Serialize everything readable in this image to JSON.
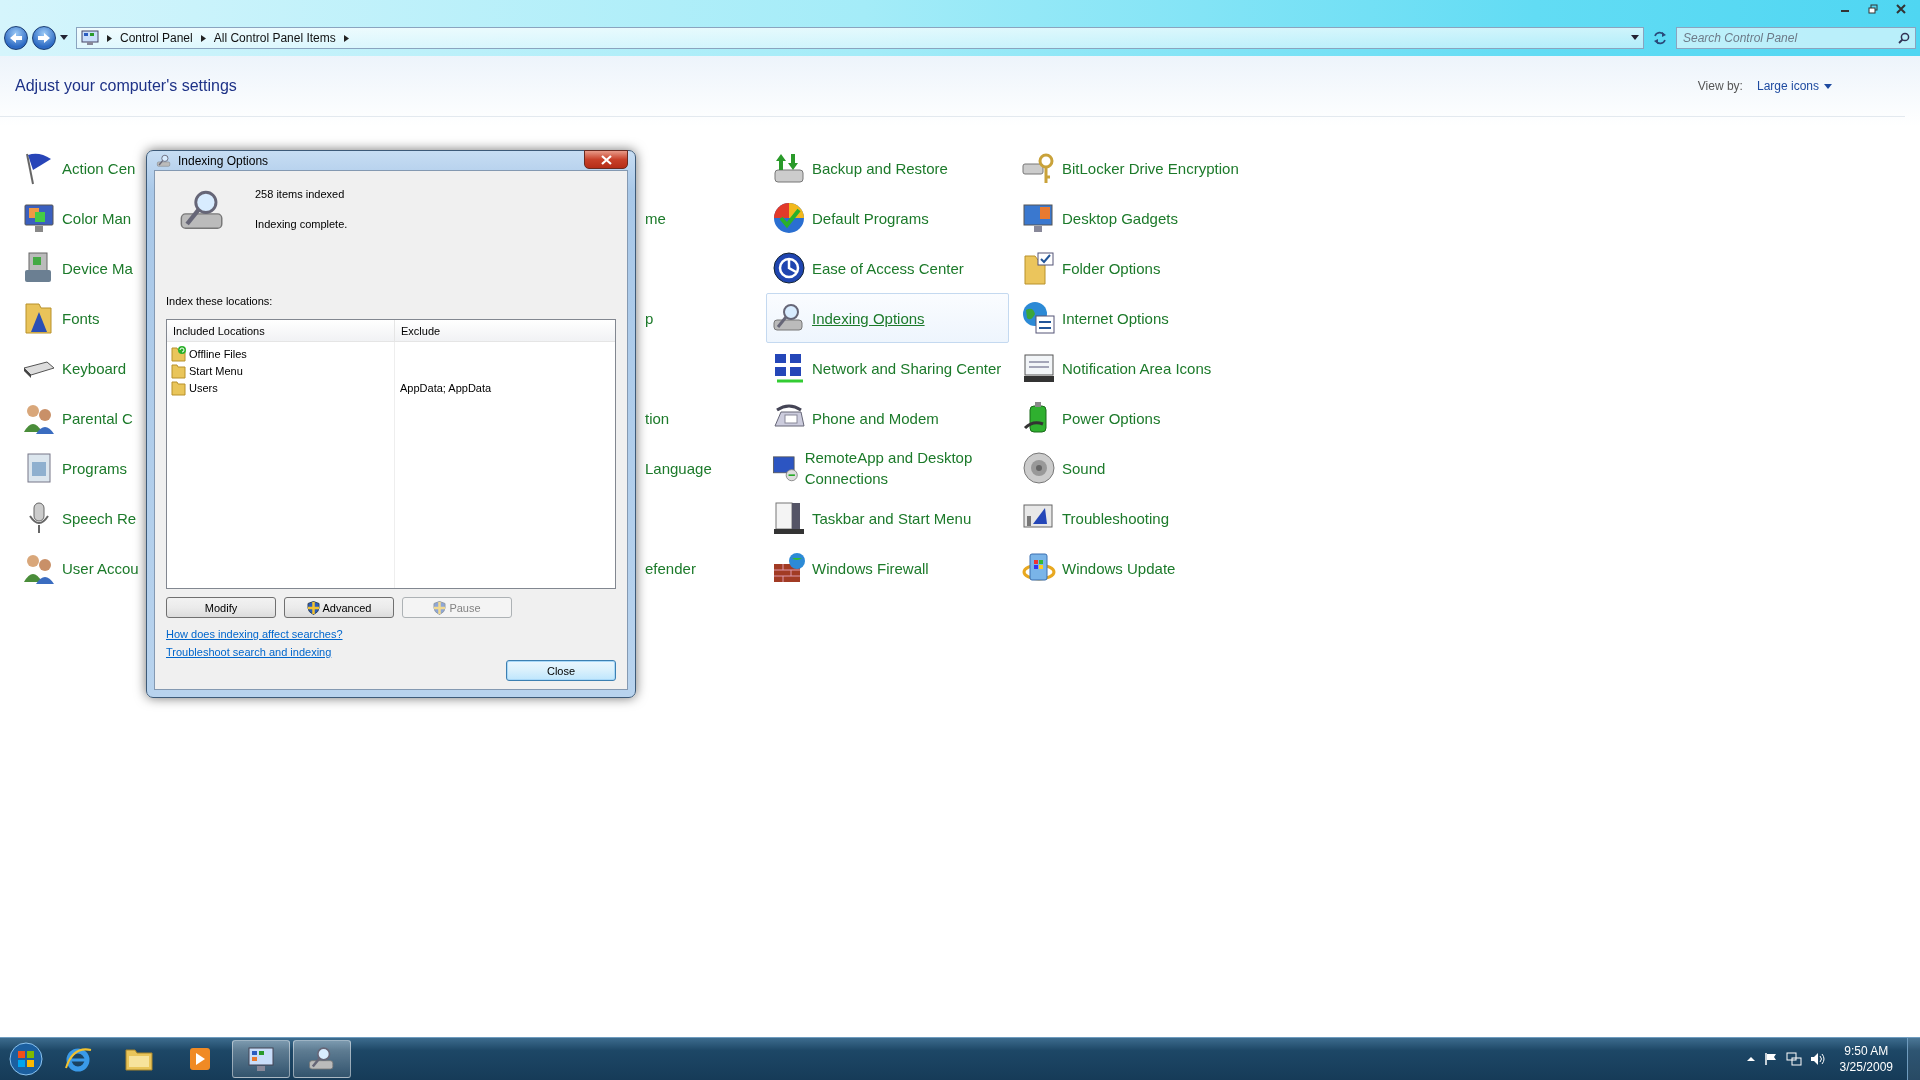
{
  "window": {
    "breadcrumbs": [
      "Control Panel",
      "All Control Panel Items"
    ],
    "search": {
      "placeholder": "Search Control Panel"
    },
    "heading": "Adjust your computer's settings",
    "view_by": {
      "label": "View by:",
      "value": "Large icons"
    }
  },
  "columns": [
    {
      "covered": false,
      "items": [
        {
          "kind": "item",
          "label": "Action Cen",
          "hovered": false
        },
        {
          "kind": "item",
          "label": "Color Man",
          "hovered": false
        },
        {
          "kind": "item",
          "label": "Device Ma",
          "hovered": false
        },
        {
          "kind": "item",
          "label": "Fonts",
          "hovered": false
        },
        {
          "kind": "item",
          "label": "Keyboard",
          "hovered": false
        },
        {
          "kind": "item",
          "label": "Parental C",
          "hovered": false
        },
        {
          "kind": "item",
          "label": "Programs",
          "hovered": false
        },
        {
          "kind": "item",
          "label": "Speech Re",
          "hovered": false
        },
        {
          "kind": "item",
          "label": "User Accou",
          "hovered": false
        }
      ]
    },
    {
      "covered": true
    },
    {
      "covered": false,
      "items": [
        {
          "kind": "covered"
        },
        {
          "kind": "tail",
          "label": "me"
        },
        {
          "kind": "covered"
        },
        {
          "kind": "tail",
          "label": "p"
        },
        {
          "kind": "covered"
        },
        {
          "kind": "tail",
          "label": "tion"
        },
        {
          "kind": "tail",
          "label": "Language"
        },
        {
          "kind": "covered"
        },
        {
          "kind": "tail",
          "label": "efender"
        }
      ]
    },
    {
      "covered": false,
      "items": [
        {
          "kind": "item",
          "label": "Backup and Restore",
          "hovered": false
        },
        {
          "kind": "item",
          "label": "Default Programs",
          "hovered": false
        },
        {
          "kind": "item",
          "label": "Ease of Access Center",
          "hovered": false
        },
        {
          "kind": "item",
          "label": "Indexing Options",
          "hovered": true
        },
        {
          "kind": "item",
          "label": "Network and Sharing Center",
          "hovered": false
        },
        {
          "kind": "item",
          "label": "Phone and Modem",
          "hovered": false
        },
        {
          "kind": "item",
          "label": "RemoteApp and Desktop Connections",
          "hovered": false
        },
        {
          "kind": "item",
          "label": "Taskbar and Start Menu",
          "hovered": false
        },
        {
          "kind": "item",
          "label": "Windows Firewall",
          "hovered": false
        }
      ]
    },
    {
      "covered": false,
      "items": [
        {
          "kind": "item",
          "label": "BitLocker Drive Encryption",
          "hovered": false
        },
        {
          "kind": "item",
          "label": "Desktop Gadgets",
          "hovered": false
        },
        {
          "kind": "item",
          "label": "Folder Options",
          "hovered": false
        },
        {
          "kind": "item",
          "label": "Internet Options",
          "hovered": false
        },
        {
          "kind": "item",
          "label": "Notification Area Icons",
          "hovered": false
        },
        {
          "kind": "item",
          "label": "Power Options",
          "hovered": false
        },
        {
          "kind": "item",
          "label": "Sound",
          "hovered": false
        },
        {
          "kind": "item",
          "label": "Troubleshooting",
          "hovered": false
        },
        {
          "kind": "item",
          "label": "Windows Update",
          "hovered": false
        }
      ]
    }
  ],
  "dialog": {
    "title": "Indexing Options",
    "items_indexed": "258 items indexed",
    "status": "Indexing complete.",
    "locations_label": "Index these locations:",
    "columns": [
      "Included Locations",
      "Exclude"
    ],
    "rows": [
      {
        "kind": "offline",
        "location": "Offline Files"
      },
      {
        "kind": "folder",
        "location": "Start Menu"
      },
      {
        "kind": "folder",
        "location": "Users",
        "exclude": "AppData; AppData"
      }
    ],
    "buttons": [
      {
        "label": "Modify",
        "shield": false,
        "disabled": false
      },
      {
        "label": "Advanced",
        "shield": true,
        "disabled": false
      },
      {
        "label": "Pause",
        "shield": true,
        "disabled": true
      }
    ],
    "links": [
      "How does indexing affect searches?",
      "Troubleshoot search and indexing"
    ],
    "close_button": "Close"
  },
  "taskbar": {
    "apps": [
      {
        "kind": "ie",
        "running": false
      },
      {
        "kind": "explorer",
        "running": false
      },
      {
        "kind": "media",
        "running": false
      },
      {
        "kind": "control-panel",
        "running": true
      },
      {
        "kind": "indexing",
        "running": true
      }
    ],
    "clock": {
      "time": "9:50 AM",
      "date": "3/25/2009"
    }
  }
}
